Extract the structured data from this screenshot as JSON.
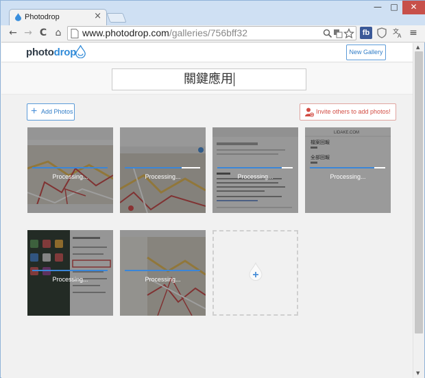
{
  "browser": {
    "tab_title": "Photodrop",
    "tab_close": "×",
    "window_controls": {
      "minimize": "—",
      "maximize": "□",
      "close": "✕"
    },
    "nav": {
      "back": "←",
      "forward": "→",
      "reload": "C",
      "home": "⌂"
    },
    "url_host": "www.photodrop.com",
    "url_path": "/galleries/756bff32",
    "omnibox_icons": [
      "search-icon",
      "translate-icon",
      "star-icon"
    ],
    "extensions": {
      "fb_label": "fb",
      "shield": "shield-icon",
      "translate": "translate-icon",
      "menu": "≡"
    }
  },
  "app": {
    "logo_photo": "photo",
    "logo_drop": "drop",
    "new_gallery_label": "New Gallery",
    "gallery_title": "關鍵應用",
    "add_photos_label": "Add Photos",
    "invite_label": "Invite others to add photos!",
    "accent_color": "#2f7cc7",
    "invite_color": "#d24b42"
  },
  "tiles": [
    {
      "status": "Processing...",
      "progress": 1.0
    },
    {
      "status": "Processing...",
      "progress": 0.75
    },
    {
      "status": "Processing...",
      "progress": 0.85
    },
    {
      "status": "Processing...",
      "progress": 0.85
    },
    {
      "status": "Processing...",
      "progress": 1.0
    },
    {
      "status": "Processing...",
      "progress": 1.0
    }
  ],
  "thumb_texts": {
    "tile4_header": "LIDAKE.COM",
    "tile4_line1": "檔案回報",
    "tile4_line2": "全部回報"
  }
}
